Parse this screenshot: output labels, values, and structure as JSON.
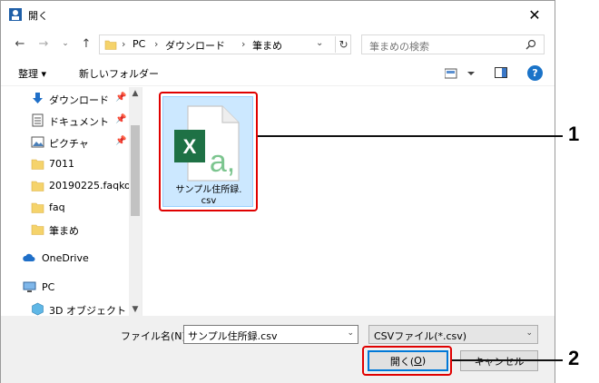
{
  "window": {
    "title": "開く"
  },
  "address": {
    "crumbs": [
      "PC",
      "ダウンロード",
      "筆まめ"
    ],
    "separator": "›"
  },
  "search": {
    "placeholder": "筆まめの検索"
  },
  "toolbar": {
    "organize_label": "整理 ▾",
    "new_folder_label": "新しいフォルダー",
    "help_label": "?"
  },
  "nav": {
    "items": [
      {
        "label": "ダウンロード",
        "icon": "download-arrow-icon",
        "pinned": true
      },
      {
        "label": "ドキュメント",
        "icon": "document-icon",
        "pinned": true
      },
      {
        "label": "ピクチャ",
        "icon": "pictures-icon",
        "pinned": true
      },
      {
        "label": "7011",
        "icon": "folder-icon"
      },
      {
        "label": "20190225.faqkok",
        "icon": "folder-icon"
      },
      {
        "label": "faq",
        "icon": "folder-icon"
      },
      {
        "label": "筆まめ",
        "icon": "folder-icon"
      },
      {
        "label": "OneDrive",
        "icon": "cloud-icon"
      },
      {
        "label": "PC",
        "icon": "computer-icon"
      },
      {
        "label": "3D オブジェクト",
        "icon": "3d-objects-icon"
      }
    ],
    "pin_glyph": "📌"
  },
  "file": {
    "name_line1": "サンプル住所録.",
    "name_line2": "csv",
    "icon": "excel-csv-icon"
  },
  "bottom": {
    "filename_label": "ファイル名(N):",
    "filename_value": "サンプル住所録.csv",
    "filetype_value": "CSVファイル(*.csv)",
    "open_label_pre": "開く(",
    "open_label_key": "O",
    "open_label_post": ")",
    "cancel_label": "キャンセル"
  },
  "callouts": {
    "one": "1",
    "two": "2"
  },
  "colors": {
    "accent": "#0078d7",
    "selection": "#cce8ff",
    "callout": "#e00000",
    "excel_green": "#1e7145"
  }
}
